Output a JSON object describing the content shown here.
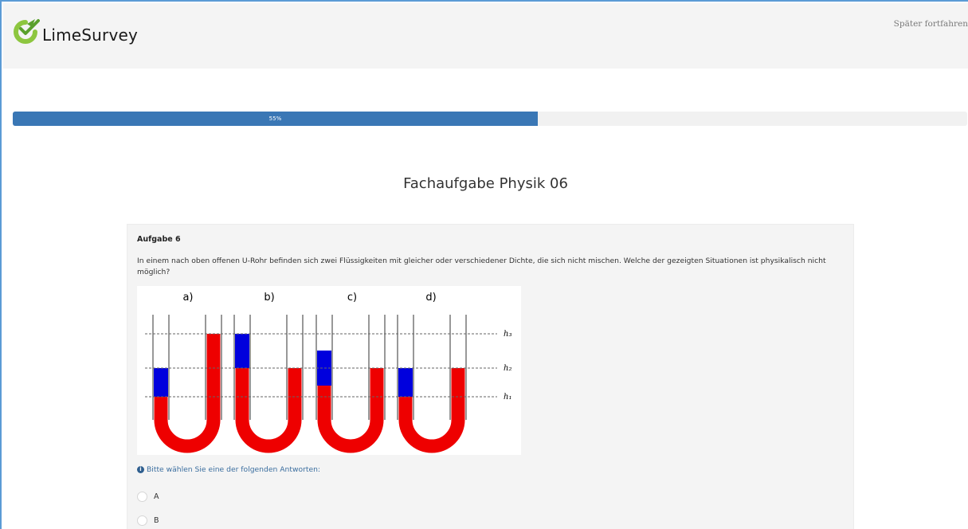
{
  "header": {
    "brand": "LimeSurvey",
    "resume_link": "Später fortfahren"
  },
  "progress": {
    "percent": 55,
    "label": "55%"
  },
  "group": {
    "title": "Fachaufgabe Physik 06"
  },
  "question": {
    "code": "Aufgabe 6",
    "text": "In einem nach oben offenen U-Rohr befinden sich zwei Flüssigkeiten mit gleicher oder verschiedener Dichte, die sich nicht mischen. Welche der gezeigten Situationen ist physikalisch nicht möglich?",
    "figure": {
      "panel_labels": [
        "a)",
        "b)",
        "c)",
        "d)"
      ],
      "level_labels": [
        "h₃",
        "h₂",
        "h₁"
      ],
      "colors": {
        "heavy_liquid": "#ee0000",
        "light_liquid": "#0000dd"
      }
    },
    "hint_icon": "info-circle-icon",
    "hint": "Bitte wählen Sie eine der folgenden Antworten:",
    "answers": [
      "A",
      "B"
    ]
  },
  "colors": {
    "progress_fill": "#3a77b5",
    "brand_green": "#8dc63f",
    "hint_text": "#3b6e9f"
  }
}
